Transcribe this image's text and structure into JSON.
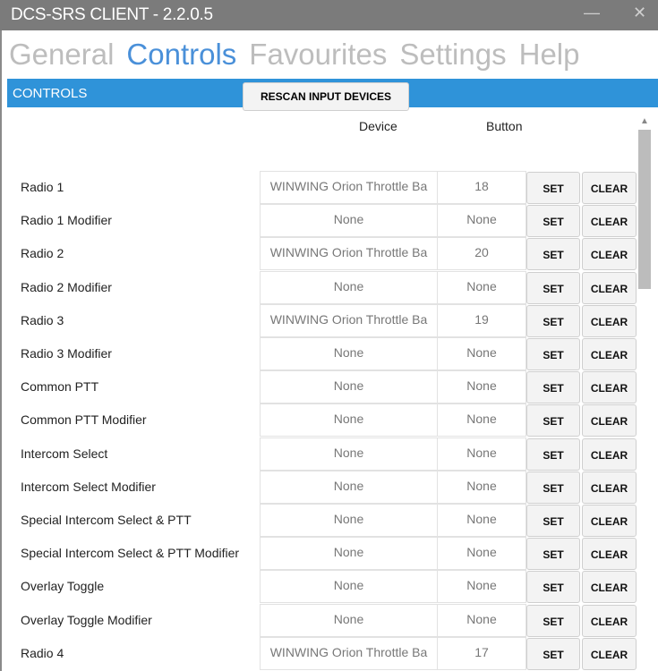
{
  "window": {
    "title": "DCS-SRS CLIENT - 2.2.0.5",
    "minimize": "—",
    "close": "✕"
  },
  "tabs": [
    "General",
    "Controls",
    "Favourites",
    "Settings",
    "Help"
  ],
  "section": "CONTROLS",
  "rescan": "RESCAN INPUT DEVICES",
  "columns": {
    "device": "Device",
    "button": "Button"
  },
  "set_label": "SET",
  "clear_label": "CLEAR",
  "rows": [
    {
      "label": "Radio 1",
      "device": "WINWING Orion Throttle Ba",
      "button": "18"
    },
    {
      "label": "Radio 1 Modifier",
      "device": "None",
      "button": "None"
    },
    {
      "label": "Radio 2",
      "device": "WINWING Orion Throttle Ba",
      "button": "20"
    },
    {
      "label": "Radio 2 Modifier",
      "device": "None",
      "button": "None"
    },
    {
      "label": "Radio 3",
      "device": "WINWING Orion Throttle Ba",
      "button": "19"
    },
    {
      "label": "Radio 3 Modifier",
      "device": "None",
      "button": "None"
    },
    {
      "label": "Common PTT",
      "device": "None",
      "button": "None"
    },
    {
      "label": "Common PTT Modifier",
      "device": "None",
      "button": "None"
    },
    {
      "label": "Intercom Select",
      "device": "None",
      "button": "None"
    },
    {
      "label": "Intercom Select Modifier",
      "device": "None",
      "button": "None"
    },
    {
      "label": "Special Intercom Select & PTT",
      "device": "None",
      "button": "None"
    },
    {
      "label": "Special Intercom Select & PTT Modifier",
      "device": "None",
      "button": "None"
    },
    {
      "label": "Overlay Toggle",
      "device": "None",
      "button": "None"
    },
    {
      "label": "Overlay Toggle Modifier",
      "device": "None",
      "button": "None"
    },
    {
      "label": "Radio 4",
      "device": "WINWING Orion Throttle Ba",
      "button": "17"
    }
  ]
}
